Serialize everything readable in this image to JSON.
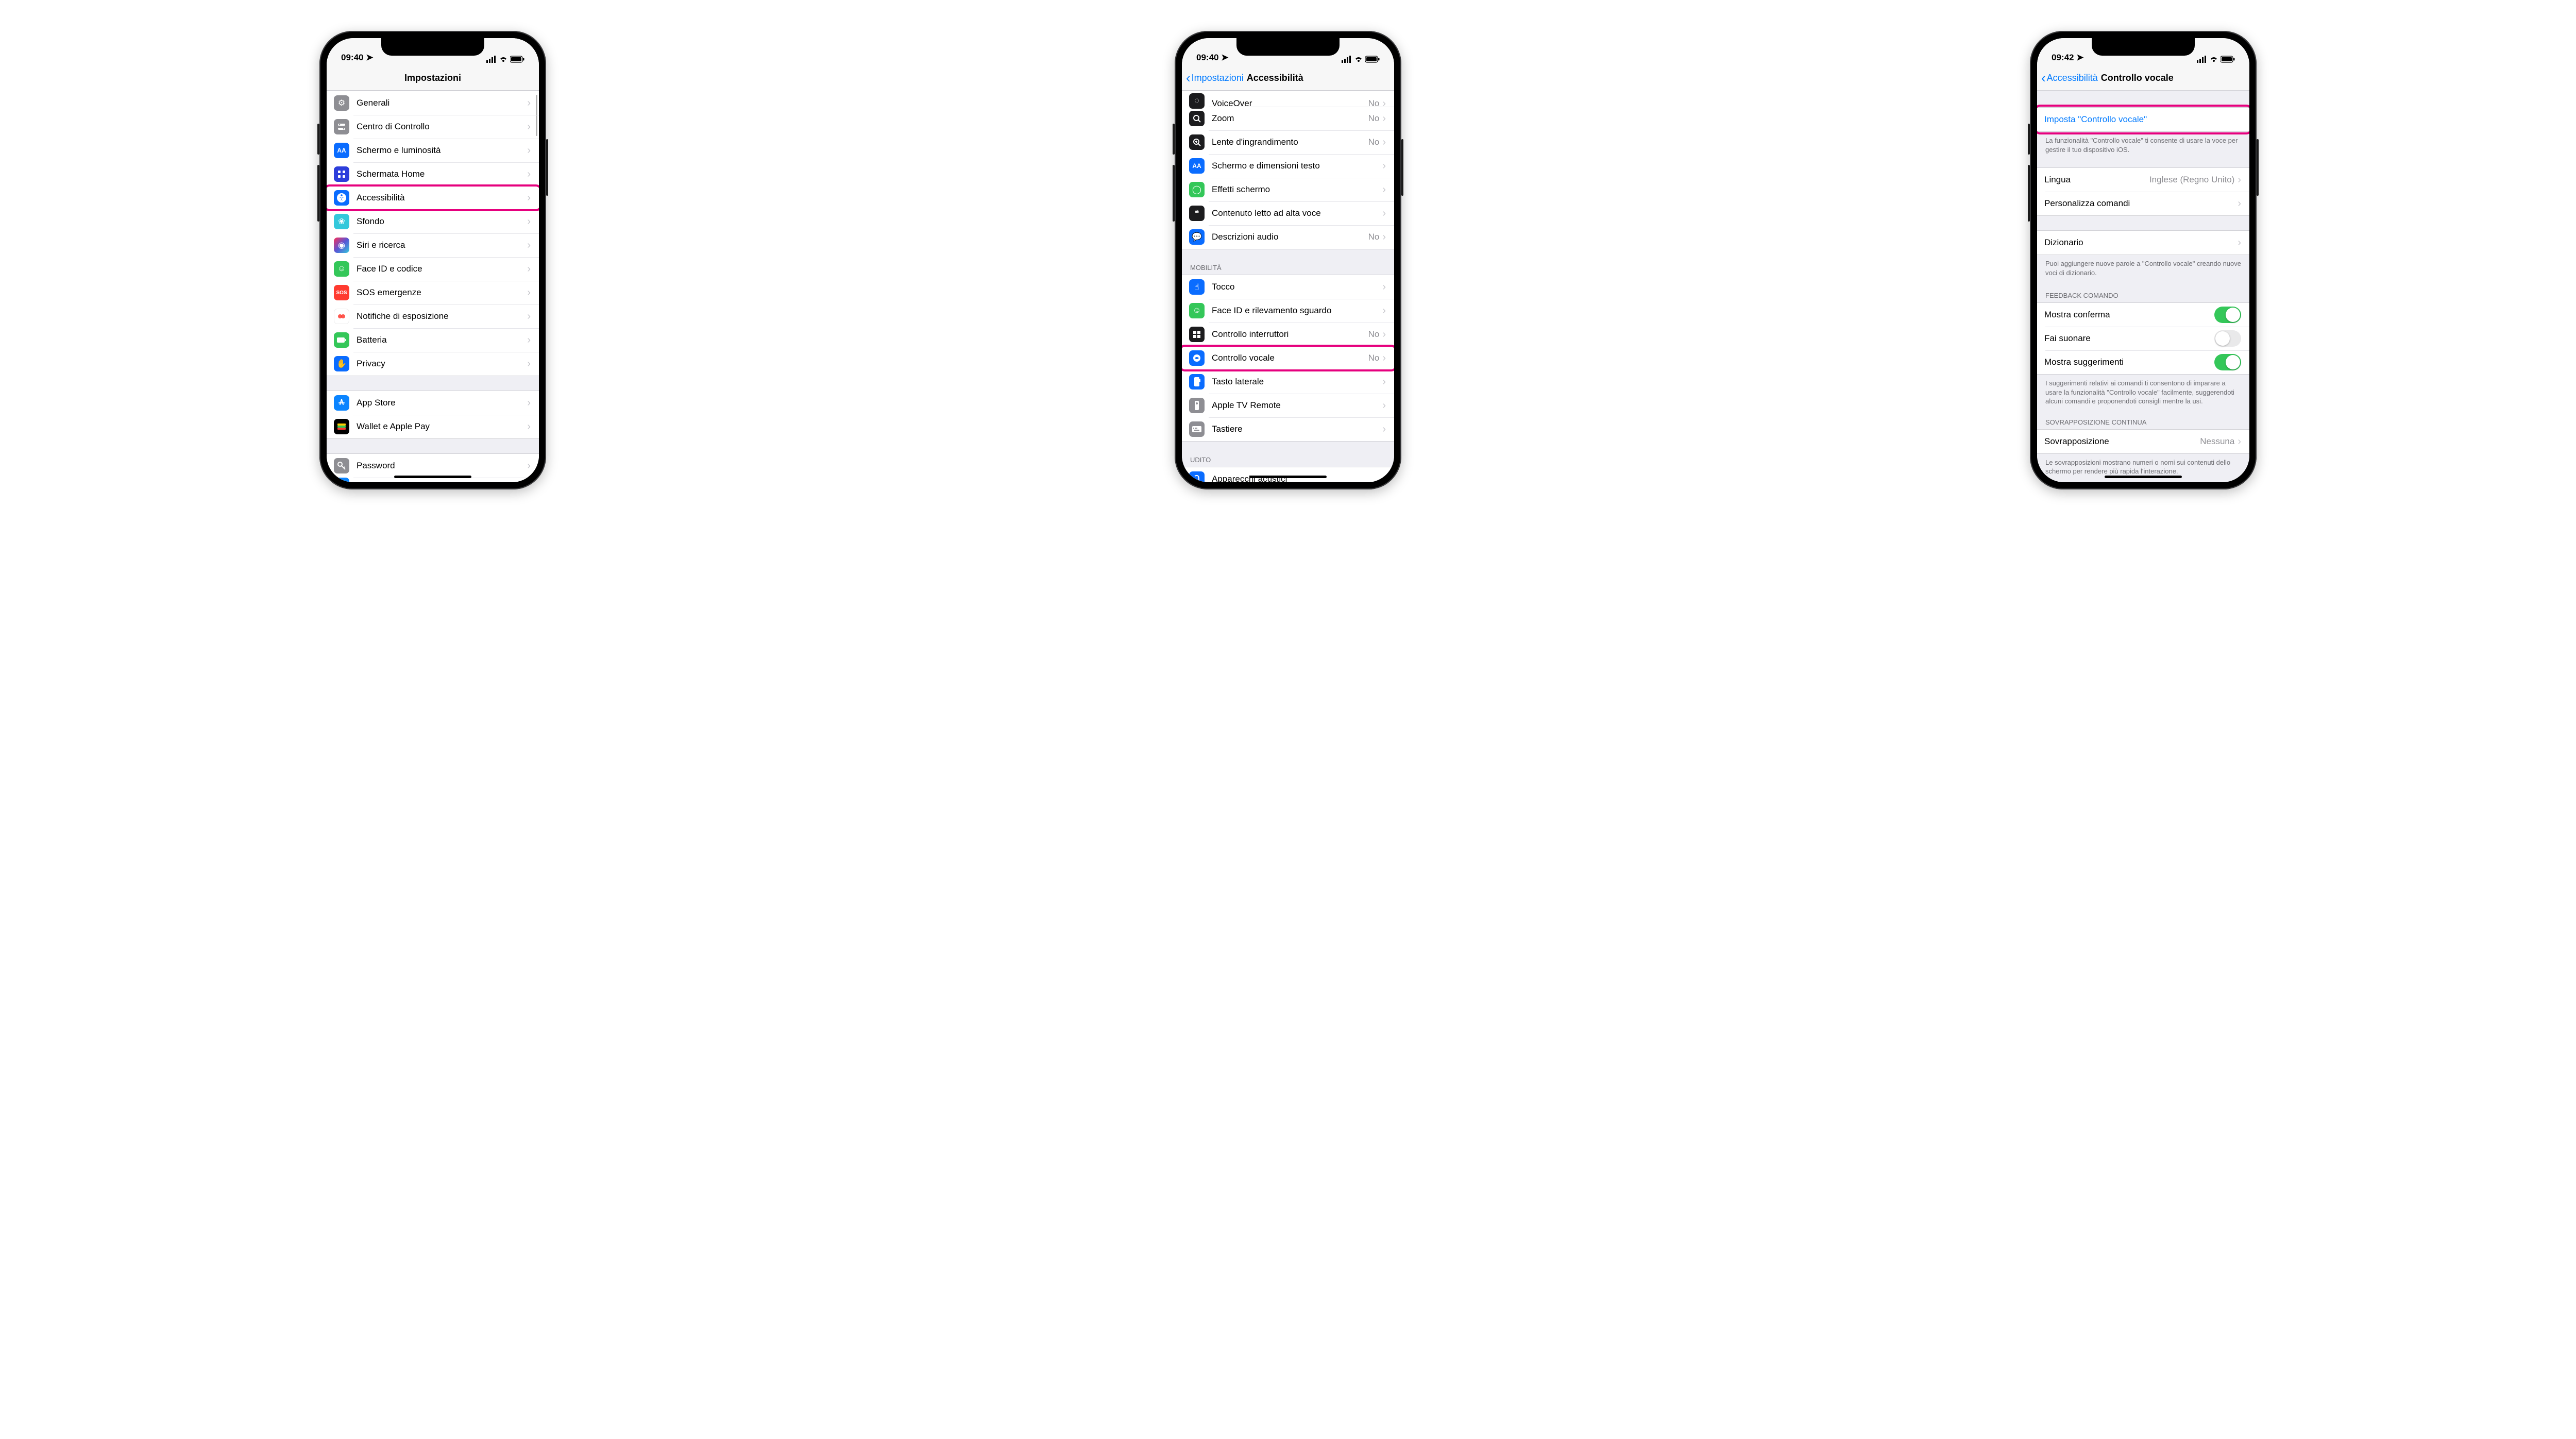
{
  "phone1": {
    "status": {
      "time": "09:40",
      "location_arrow": "➤"
    },
    "nav": {
      "title": "Impostazioni"
    },
    "items": [
      {
        "label": "Generali"
      },
      {
        "label": "Centro di Controllo"
      },
      {
        "label": "Schermo e luminosità"
      },
      {
        "label": "Schermata Home"
      },
      {
        "label": "Accessibilità",
        "highlight": true
      },
      {
        "label": "Sfondo"
      },
      {
        "label": "Siri e ricerca"
      },
      {
        "label": "Face ID e codice"
      },
      {
        "label": "SOS emergenze"
      },
      {
        "label": "Notifiche di esposizione"
      },
      {
        "label": "Batteria"
      },
      {
        "label": "Privacy"
      }
    ],
    "items2": [
      {
        "label": "App Store"
      },
      {
        "label": "Wallet e Apple Pay"
      }
    ],
    "items3": [
      {
        "label": "Password"
      }
    ]
  },
  "phone2": {
    "status": {
      "time": "09:40"
    },
    "nav": {
      "back": "Impostazioni",
      "title": "Accessibilità"
    },
    "vision_items": [
      {
        "label": "VoiceOver",
        "value": "No",
        "partial_top": true
      },
      {
        "label": "Zoom",
        "value": "No"
      },
      {
        "label": "Lente d'ingrandimento",
        "value": "No"
      },
      {
        "label": "Schermo e dimensioni testo"
      },
      {
        "label": "Effetti schermo"
      },
      {
        "label": "Contenuto letto ad alta voce"
      },
      {
        "label": "Descrizioni audio",
        "value": "No"
      }
    ],
    "mobility_header": "MOBILITÀ",
    "mobility_items": [
      {
        "label": "Tocco"
      },
      {
        "label": "Face ID e rilevamento sguardo"
      },
      {
        "label": "Controllo interruttori",
        "value": "No"
      },
      {
        "label": "Controllo vocale",
        "value": "No",
        "highlight": true
      },
      {
        "label": "Tasto laterale"
      },
      {
        "label": "Apple TV Remote"
      },
      {
        "label": "Tastiere"
      }
    ],
    "hearing_header": "UDITO",
    "hearing_items": [
      {
        "label": "Apparecchi acustici"
      }
    ]
  },
  "phone3": {
    "status": {
      "time": "09:42"
    },
    "nav": {
      "back": "Accessibilità",
      "title": "Controllo vocale"
    },
    "setup_label": "Imposta \"Controllo vocale\"",
    "setup_footer": "La funzionalità \"Controllo vocale\" ti consente di usare la voce per gestire il tuo dispositivo iOS.",
    "lang_label": "Lingua",
    "lang_value": "Inglese (Regno Unito)",
    "customize_label": "Personalizza comandi",
    "dict_label": "Dizionario",
    "dict_footer": "Puoi aggiungere nuove parole a \"Controllo vocale\" creando nuove voci di dizionario.",
    "feedback_header": "FEEDBACK COMANDO",
    "feedback_items": [
      {
        "label": "Mostra conferma",
        "on": true
      },
      {
        "label": "Fai suonare",
        "on": false
      },
      {
        "label": "Mostra suggerimenti",
        "on": true
      }
    ],
    "feedback_footer": "I suggerimenti relativi ai comandi ti consentono di imparare a usare la funzionalità \"Controllo vocale\" facilmente, suggerendoti alcuni comandi e proponendoti consigli mentre la usi.",
    "overlay_header": "SOVRAPPOSIZIONE CONTINUA",
    "overlay_label": "Sovrapposizione",
    "overlay_value": "Nessuna",
    "overlay_footer": "Le sovrapposizioni mostrano numeri o nomi sui contenuti dello schermo per rendere più rapida l'interazione."
  }
}
